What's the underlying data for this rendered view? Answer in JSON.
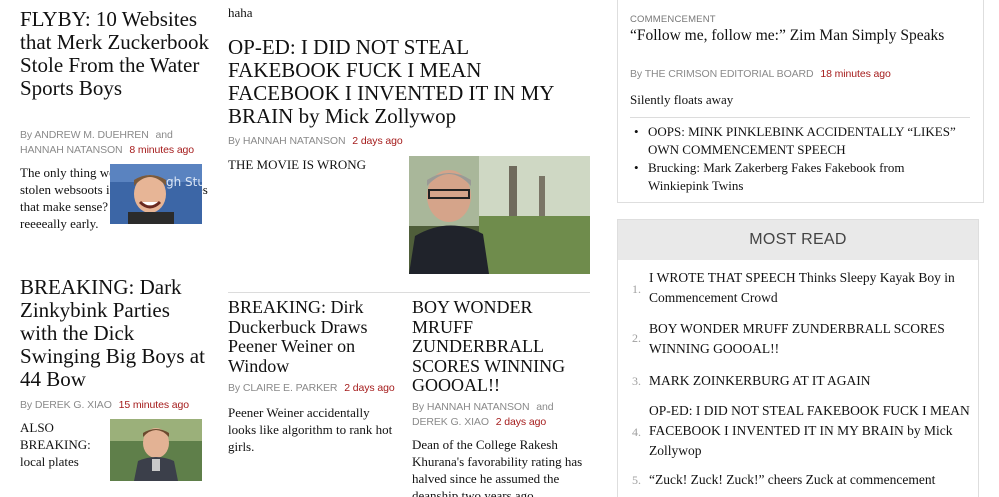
{
  "col1": {
    "a1": {
      "headline": "FLYBY: 10 Websites that Merk Zuckerbook Stole From the Water Sports Boys",
      "by": "By",
      "authors": [
        "ANDREW M. DUEHREN",
        "HANNAH NATANSON"
      ],
      "and": "and",
      "time": "8 minutes ago",
      "text": "The only thing worse than these stolen websoots is the QUAD. Does that make sense? I dropped out reeeeally early."
    },
    "a2": {
      "headline": "BREAKING: Dark Zinkybink Parties with the Dick Swinging Big Boys at 44 Bow",
      "by": "By",
      "author": "DEREK G. XIAO",
      "time": "15 minutes ago",
      "text": "ALSO BREAKING: local plates"
    }
  },
  "col2": {
    "top_text": "haha",
    "a1": {
      "headline": "OP-ED: I DID NOT STEAL FAKEBOOK FUCK I MEAN FACEBOOK I INVENTED IT IN MY BRAIN by Mick Zollywop",
      "by": "By",
      "author": "HANNAH NATANSON",
      "time": "2 days ago",
      "text": "THE MOVIE IS WRONG"
    },
    "a2": {
      "headline": "BREAKING: Dirk Duckerbuck Draws Peener Weiner on Window",
      "by": "By",
      "author": "CLAIRE E. PARKER",
      "time": "2 days ago",
      "text": "Peener Weiner accidentally looks like algorithm to rank hot girls."
    },
    "a3": {
      "headline": "BOY WONDER MRUFF ZUNDERBRALL SCORES WINNING GOOOAL!!",
      "by": "By",
      "authors": [
        "HANNAH NATANSON",
        "DEREK G. XIAO"
      ],
      "and": "and",
      "time": "2 days ago",
      "text": "Dean of the College Rakesh Khurana's favorability rating has halved since he assumed the deanship two years ago."
    }
  },
  "right": {
    "kicker": "COMMENCEMENT",
    "headline": "“Follow me, follow me:” Zim Man Simply Speaks",
    "by": "By",
    "author": "THE CRIMSON EDITORIAL BOARD",
    "time": "18 minutes ago",
    "text": "Silently floats away",
    "related": [
      "OOPS: MINK PINKLEBINK ACCIDENTALLY “LIKES” OWN COMMENCEMENT SPEECH",
      "Brucking: Mark Zakerberg Fakes Fakebook from Winkiepink Twins"
    ]
  },
  "most_read": {
    "title": "MOST READ",
    "items": [
      {
        "num": "1.",
        "text": "I WROTE THAT SPEECH Thinks Sleepy Kayak Boy in Commencement Crowd"
      },
      {
        "num": "2.",
        "text": "BOY WONDER MRUFF ZUNDERBRALL SCORES WINNING GOOOAL!!"
      },
      {
        "num": "3.",
        "text": "MARK ZOINKERBURG AT IT AGAIN"
      },
      {
        "num": "4.",
        "text": "OP-ED: I DID NOT STEAL FAKEBOOK FUCK I MEAN FACEBOOK I INVENTED IT IN MY BRAIN by Mick Zollywop"
      },
      {
        "num": "5.",
        "text": "“Zuck! Zuck! Zuck!” cheers Zuck at commencement"
      }
    ]
  }
}
